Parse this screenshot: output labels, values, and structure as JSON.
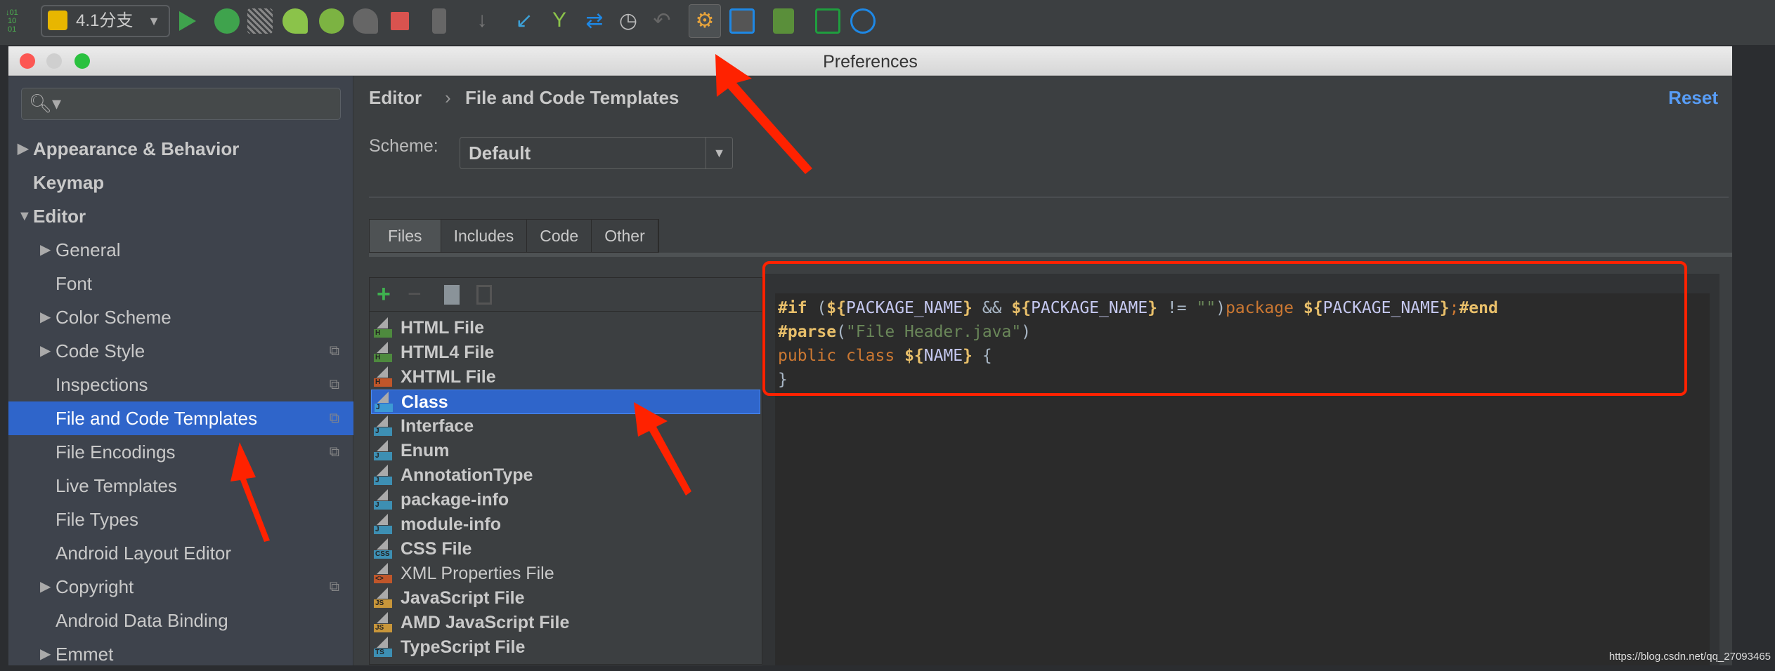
{
  "toolbar": {
    "run_config": "4.1分支",
    "icons": [
      "vcs-update-icon",
      "tomcat-icon",
      "run-icon",
      "debug-icon",
      "coverage-icon",
      "jrebel-run-icon",
      "jrebel-debug-icon",
      "android-icon",
      "stop-icon",
      "device-icon",
      "download-icon",
      "git-update-icon",
      "git-branch-icon",
      "git-merge-icon",
      "history-icon",
      "revert-icon",
      "settings-icon",
      "project-structure-icon",
      "sdk-manager-icon",
      "monitor-icon",
      "block-icon"
    ]
  },
  "dialog": {
    "title": "Preferences"
  },
  "sidebar": {
    "search_placeholder": "",
    "items": [
      {
        "label": "Appearance & Behavior",
        "expand": "collapsed",
        "level": 0
      },
      {
        "label": "Keymap",
        "level": 0
      },
      {
        "label": "Editor",
        "expand": "expanded",
        "level": 0
      },
      {
        "label": "General",
        "expand": "collapsed",
        "level": 1
      },
      {
        "label": "Font",
        "level": 1
      },
      {
        "label": "Color Scheme",
        "expand": "collapsed",
        "level": 1
      },
      {
        "label": "Code Style",
        "expand": "collapsed",
        "level": 1,
        "copy": true
      },
      {
        "label": "Inspections",
        "level": 1,
        "copy": true
      },
      {
        "label": "File and Code Templates",
        "level": 1,
        "copy": true,
        "selected": true
      },
      {
        "label": "File Encodings",
        "level": 1,
        "copy": true
      },
      {
        "label": "Live Templates",
        "level": 1
      },
      {
        "label": "File Types",
        "level": 1
      },
      {
        "label": "Android Layout Editor",
        "level": 1
      },
      {
        "label": "Copyright",
        "expand": "collapsed",
        "level": 1,
        "copy": true
      },
      {
        "label": "Android Data Binding",
        "level": 1
      },
      {
        "label": "Emmet",
        "expand": "collapsed",
        "level": 1
      }
    ]
  },
  "main": {
    "breadcrumb": [
      "Editor",
      "File and Code Templates"
    ],
    "breadcrumb_sep": "›",
    "reset": "Reset",
    "scheme_label": "Scheme:",
    "scheme_value": "Default",
    "tabs": [
      "Files",
      "Includes",
      "Code",
      "Other"
    ],
    "active_tab": "Files",
    "templates": [
      {
        "label": "HTML File",
        "badge": "H",
        "color": "#4e8a3e"
      },
      {
        "label": "HTML4 File",
        "badge": "H",
        "color": "#4e8a3e"
      },
      {
        "label": "XHTML File",
        "badge": "H",
        "color": "#c0562a"
      },
      {
        "label": "Class",
        "badge": "J",
        "color": "#3d9ad4",
        "selected": true
      },
      {
        "label": "Interface",
        "badge": "J",
        "color": "#3d8fb3"
      },
      {
        "label": "Enum",
        "badge": "J",
        "color": "#3d8fb3"
      },
      {
        "label": "AnnotationType",
        "badge": "J",
        "color": "#3d8fb3"
      },
      {
        "label": "package-info",
        "badge": "J",
        "color": "#3d8fb3"
      },
      {
        "label": "module-info",
        "badge": "J",
        "color": "#3d8fb3"
      },
      {
        "label": "CSS File",
        "badge": "CSS",
        "color": "#3d8fb3"
      },
      {
        "label": "XML Properties File",
        "badge": "<>",
        "color": "#c0562a",
        "plain": true
      },
      {
        "label": "JavaScript File",
        "badge": "JS",
        "color": "#c8963a"
      },
      {
        "label": "AMD JavaScript File",
        "badge": "JS",
        "color": "#c8963a"
      },
      {
        "label": "TypeScript File",
        "badge": "TS",
        "color": "#3d8fb3"
      }
    ],
    "code": [
      "#if (${PACKAGE_NAME} && ${PACKAGE_NAME} != \"\")package ${PACKAGE_NAME};#end",
      "#parse(\"File Header.java\")",
      "public class ${NAME} {",
      "}"
    ]
  },
  "watermark": "https://blog.csdn.net/qq_27093465",
  "colors": {
    "selection": "#2f65ca",
    "link": "#589df6",
    "annotation": "#ff2200"
  }
}
